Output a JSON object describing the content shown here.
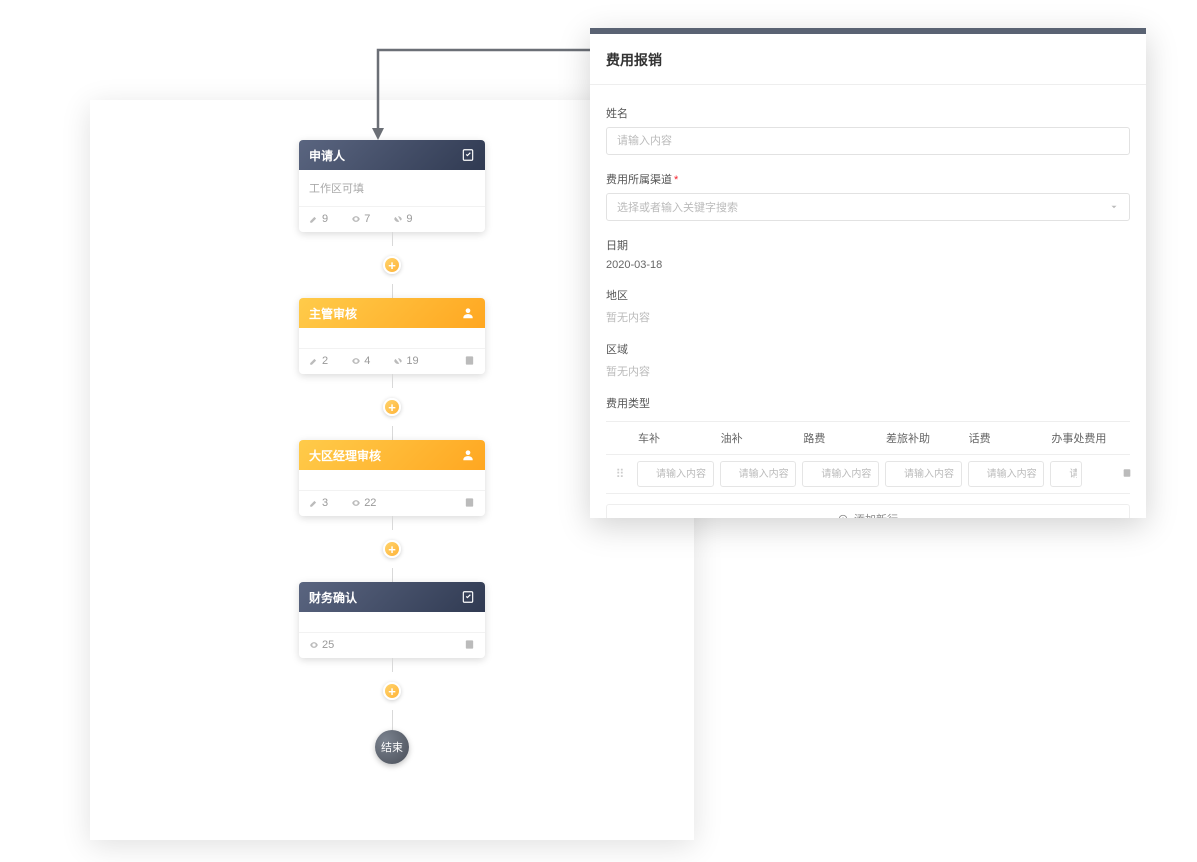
{
  "workflow": {
    "nodes": [
      {
        "title": "申请人",
        "variant": "dark",
        "body": "工作区可填",
        "header_icon": "form-icon",
        "stats": {
          "edit": 9,
          "view": 7,
          "hide": 9
        },
        "show_card_settings": false
      },
      {
        "title": "主管审核",
        "variant": "orange",
        "body": "",
        "header_icon": "person-icon",
        "stats": {
          "edit": 2,
          "view": 4,
          "hide": 19
        },
        "show_card_settings": true
      },
      {
        "title": "大区经理审核",
        "variant": "orange",
        "body": "",
        "header_icon": "person-icon",
        "stats": {
          "edit": 3,
          "view": 22
        },
        "show_card_settings": true
      },
      {
        "title": "财务确认",
        "variant": "dark",
        "body": "",
        "header_icon": "form-icon",
        "stats": {
          "view": 25
        },
        "show_card_settings": true
      }
    ],
    "end_label": "结束"
  },
  "form": {
    "title": "费用报销",
    "fields": {
      "name_label": "姓名",
      "name_placeholder": "请输入内容",
      "channel_label": "费用所属渠道",
      "channel_placeholder": "选择或者输入关键字搜索",
      "date_label": "日期",
      "date_value": "2020-03-18",
      "region_label": "地区",
      "region_value": "暂无内容",
      "area_label": "区域",
      "area_value": "暂无内容",
      "type_label": "费用类型"
    },
    "table": {
      "columns": [
        "车补",
        "油补",
        "路费",
        "差旅补助",
        "话费",
        "办事处费用"
      ],
      "cell_placeholder": "请输入内容",
      "cell_placeholder_short": "请输入",
      "add_row": "添加新行"
    }
  }
}
